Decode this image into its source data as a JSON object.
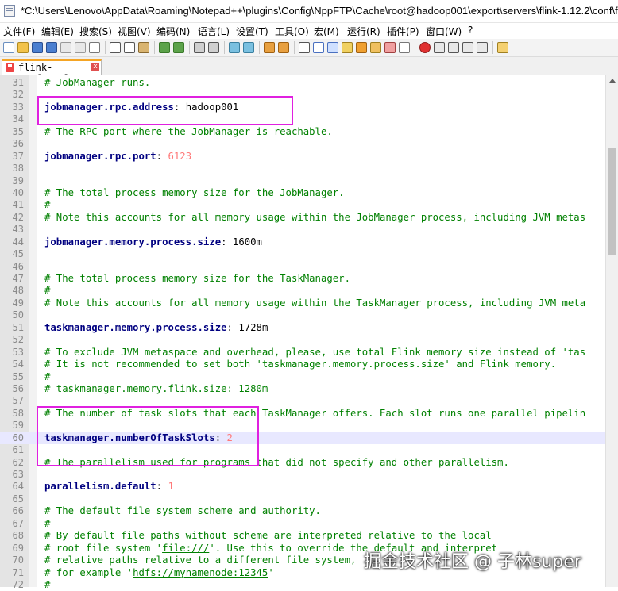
{
  "window": {
    "title": "*C:\\Users\\Lenovo\\AppData\\Roaming\\Notepad++\\plugins\\Config\\NppFTP\\Cache\\root@hadoop001\\export\\servers\\flink-1.12.2\\conf\\f"
  },
  "menu": [
    "文件(F)",
    "编辑(E)",
    "搜索(S)",
    "视图(V)",
    "编码(N)",
    "语言(L)",
    "设置(T)",
    "工具(O)",
    "宏(M)",
    "运行(R)",
    "插件(P)",
    "窗口(W)",
    "?"
  ],
  "tab": {
    "label": "flink-conf.yaml",
    "close": "x"
  },
  "watermark": "掘金技术社区 @ 子林super",
  "lines": [
    {
      "n": "31",
      "parts": [
        {
          "t": "# JobManager runs.",
          "c": "comment"
        }
      ]
    },
    {
      "n": "32",
      "parts": []
    },
    {
      "n": "33",
      "parts": [
        {
          "t": "jobmanager.rpc.address",
          "c": "key"
        },
        {
          "t": ": ",
          "c": "sep"
        },
        {
          "t": "hadoop001",
          "c": "val"
        }
      ]
    },
    {
      "n": "34",
      "parts": []
    },
    {
      "n": "35",
      "parts": [
        {
          "t": "# The RPC port where the JobManager is reachable.",
          "c": "comment"
        }
      ]
    },
    {
      "n": "36",
      "parts": []
    },
    {
      "n": "37",
      "parts": [
        {
          "t": "jobmanager.rpc.port",
          "c": "key"
        },
        {
          "t": ": ",
          "c": "sep"
        },
        {
          "t": "6123",
          "c": "num"
        }
      ]
    },
    {
      "n": "38",
      "parts": []
    },
    {
      "n": "39",
      "parts": []
    },
    {
      "n": "40",
      "parts": [
        {
          "t": "# The total process memory size for the JobManager.",
          "c": "comment"
        }
      ]
    },
    {
      "n": "41",
      "parts": [
        {
          "t": "#",
          "c": "comment"
        }
      ]
    },
    {
      "n": "42",
      "parts": [
        {
          "t": "# Note this accounts for all memory usage within the JobManager process, including JVM metas",
          "c": "comment"
        }
      ]
    },
    {
      "n": "43",
      "parts": []
    },
    {
      "n": "44",
      "parts": [
        {
          "t": "jobmanager.memory.process.size",
          "c": "key"
        },
        {
          "t": ": ",
          "c": "sep"
        },
        {
          "t": "1600m",
          "c": "val"
        }
      ]
    },
    {
      "n": "45",
      "parts": []
    },
    {
      "n": "46",
      "parts": []
    },
    {
      "n": "47",
      "parts": [
        {
          "t": "# The total process memory size for the TaskManager.",
          "c": "comment"
        }
      ]
    },
    {
      "n": "48",
      "parts": [
        {
          "t": "#",
          "c": "comment"
        }
      ]
    },
    {
      "n": "49",
      "parts": [
        {
          "t": "# Note this accounts for all memory usage within the TaskManager process, including JVM meta",
          "c": "comment"
        }
      ]
    },
    {
      "n": "50",
      "parts": []
    },
    {
      "n": "51",
      "parts": [
        {
          "t": "taskmanager.memory.process.size",
          "c": "key"
        },
        {
          "t": ": ",
          "c": "sep"
        },
        {
          "t": "1728m",
          "c": "val"
        }
      ]
    },
    {
      "n": "52",
      "parts": []
    },
    {
      "n": "53",
      "parts": [
        {
          "t": "# To exclude JVM metaspace and overhead, please, use total Flink memory size instead of 'tas",
          "c": "comment"
        }
      ]
    },
    {
      "n": "54",
      "parts": [
        {
          "t": "# It is not recommended to set both 'taskmanager.memory.process.size' and Flink memory.",
          "c": "comment"
        }
      ]
    },
    {
      "n": "55",
      "parts": [
        {
          "t": "#",
          "c": "comment"
        }
      ]
    },
    {
      "n": "56",
      "parts": [
        {
          "t": "# taskmanager.memory.flink.size: 1280m",
          "c": "comment"
        }
      ]
    },
    {
      "n": "57",
      "parts": []
    },
    {
      "n": "58",
      "parts": [
        {
          "t": "# The number of task slots that each TaskManager offers. Each slot runs one parallel pipelin",
          "c": "comment"
        }
      ]
    },
    {
      "n": "59",
      "parts": []
    },
    {
      "n": "60",
      "parts": [
        {
          "t": "taskmanager.numberOfTaskSlots",
          "c": "key"
        },
        {
          "t": ": ",
          "c": "sep"
        },
        {
          "t": "2",
          "c": "num"
        }
      ],
      "current": true
    },
    {
      "n": "61",
      "parts": []
    },
    {
      "n": "62",
      "parts": [
        {
          "t": "# The parallelism used for programs that did not specify and other parallelism.",
          "c": "comment"
        }
      ]
    },
    {
      "n": "63",
      "parts": []
    },
    {
      "n": "64",
      "parts": [
        {
          "t": "parallelism.default",
          "c": "key"
        },
        {
          "t": ": ",
          "c": "sep"
        },
        {
          "t": "1",
          "c": "num"
        }
      ]
    },
    {
      "n": "65",
      "parts": []
    },
    {
      "n": "66",
      "parts": [
        {
          "t": "# The default file system scheme and authority.",
          "c": "comment"
        }
      ]
    },
    {
      "n": "67",
      "parts": [
        {
          "t": "#",
          "c": "comment"
        }
      ]
    },
    {
      "n": "68",
      "parts": [
        {
          "t": "# By default file paths without scheme are interpreted relative to the local",
          "c": "comment"
        }
      ]
    },
    {
      "n": "69",
      "parts": [
        {
          "t": "# root file system '",
          "c": "comment"
        },
        {
          "t": "file:///",
          "c": "comment uline"
        },
        {
          "t": "'. Use this to override the default and interpret",
          "c": "comment"
        }
      ]
    },
    {
      "n": "70",
      "parts": [
        {
          "t": "# relative paths relative to a different file system,",
          "c": "comment"
        }
      ]
    },
    {
      "n": "71",
      "parts": [
        {
          "t": "# for example '",
          "c": "comment"
        },
        {
          "t": "hdfs://mynamenode:12345",
          "c": "comment uline"
        },
        {
          "t": "'",
          "c": "comment"
        }
      ]
    },
    {
      "n": "72",
      "parts": [
        {
          "t": "#",
          "c": "comment"
        }
      ]
    }
  ]
}
